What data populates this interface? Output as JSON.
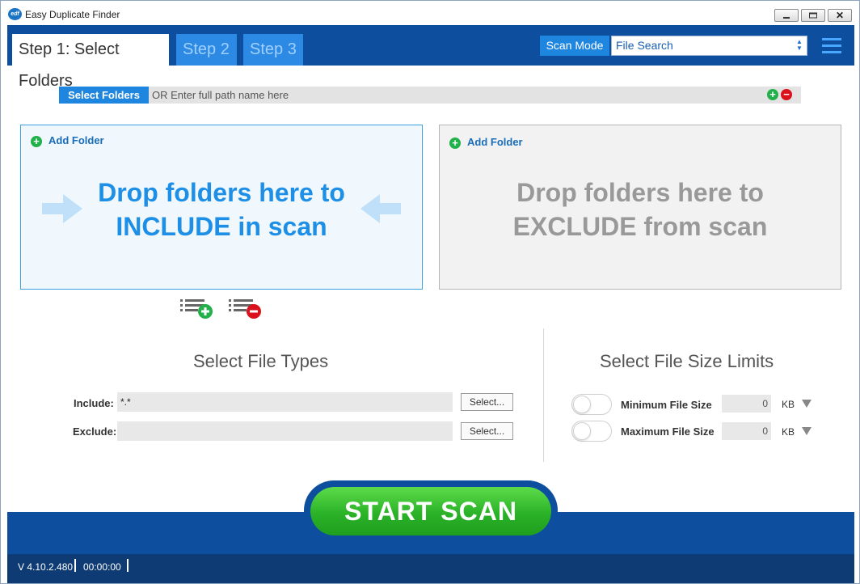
{
  "window": {
    "title": "Easy Duplicate Finder",
    "logo_text": "edf"
  },
  "tabs": [
    {
      "label": "Step 1: Select Folders",
      "active": true
    },
    {
      "label": "Step 2",
      "active": false
    },
    {
      "label": "Step 3",
      "active": false
    }
  ],
  "scan_mode": {
    "label": "Scan Mode",
    "value": "File Search"
  },
  "path_bar": {
    "button_label": "Select Folders",
    "placeholder": "OR Enter full path name here"
  },
  "include_zone": {
    "add_label": "Add Folder",
    "text_line1": "Drop folders here to",
    "text_line2": "INCLUDE in scan"
  },
  "exclude_zone": {
    "add_label": "Add Folder",
    "text_line1": "Drop folders here to",
    "text_line2": "EXCLUDE from scan"
  },
  "file_types": {
    "title": "Select File Types",
    "include_label": "Include:",
    "include_value": "*.*",
    "exclude_label": "Exclude:",
    "exclude_value": "",
    "select_label": "Select..."
  },
  "file_size": {
    "title": "Select File Size Limits",
    "min_label": "Minimum File Size",
    "min_value": "0",
    "max_label": "Maximum File Size",
    "max_value": "0",
    "unit": "KB"
  },
  "start_scan_label": "START  SCAN",
  "status": {
    "version": "V 4.10.2.480",
    "timer": "00:00:00"
  },
  "colors": {
    "brand_blue": "#0d4f9e",
    "accent_blue": "#1f86e0",
    "scan_green": "#2bb228"
  }
}
